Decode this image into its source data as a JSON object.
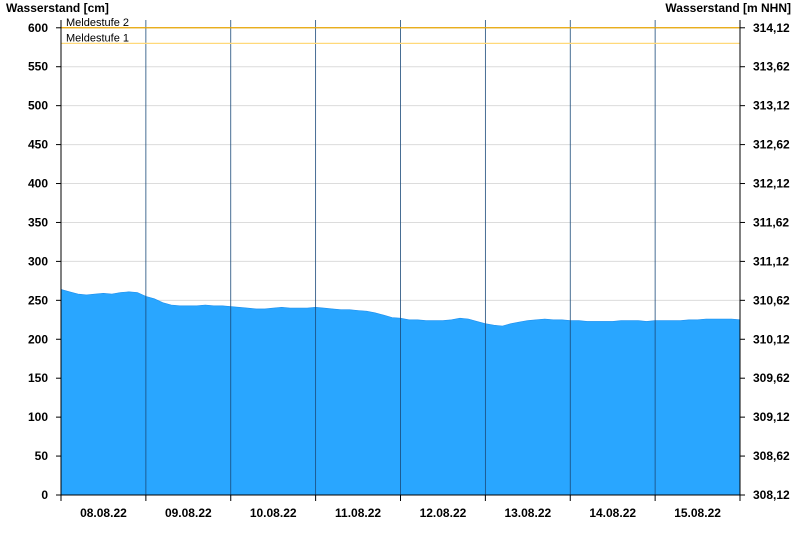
{
  "chart_data": {
    "type": "area",
    "title": "",
    "ylabel_left": "Wasserstand [cm]",
    "ylabel_right": "Wasserstand [m NHN]",
    "ylim": [
      0,
      610
    ],
    "y_ticks_left": [
      0,
      50,
      100,
      150,
      200,
      250,
      300,
      350,
      400,
      450,
      500,
      550,
      600
    ],
    "y_ticks_right": [
      "308,12",
      "308,62",
      "309,12",
      "309,62",
      "310,12",
      "310,62",
      "311,12",
      "311,62",
      "312,12",
      "312,62",
      "313,12",
      "313,62",
      "314,12"
    ],
    "x_ticks": [
      "08.08.22",
      "09.08.22",
      "10.08.22",
      "11.08.22",
      "12.08.22",
      "13.08.22",
      "14.08.22",
      "15.08.22"
    ],
    "x_range_days": [
      0,
      8
    ],
    "grid": true,
    "series": [
      {
        "color": "#29a6ff",
        "points": [
          [
            0.0,
            264
          ],
          [
            0.1,
            261
          ],
          [
            0.2,
            258
          ],
          [
            0.3,
            257
          ],
          [
            0.4,
            258
          ],
          [
            0.5,
            259
          ],
          [
            0.6,
            258
          ],
          [
            0.7,
            260
          ],
          [
            0.8,
            261
          ],
          [
            0.9,
            260
          ],
          [
            1.0,
            255
          ],
          [
            1.1,
            252
          ],
          [
            1.2,
            247
          ],
          [
            1.3,
            244
          ],
          [
            1.4,
            243
          ],
          [
            1.5,
            243
          ],
          [
            1.6,
            243
          ],
          [
            1.7,
            244
          ],
          [
            1.8,
            243
          ],
          [
            1.9,
            243
          ],
          [
            2.0,
            242
          ],
          [
            2.1,
            241
          ],
          [
            2.2,
            240
          ],
          [
            2.3,
            239
          ],
          [
            2.4,
            239
          ],
          [
            2.5,
            240
          ],
          [
            2.6,
            241
          ],
          [
            2.7,
            240
          ],
          [
            2.8,
            240
          ],
          [
            2.9,
            240
          ],
          [
            3.0,
            241
          ],
          [
            3.1,
            240
          ],
          [
            3.2,
            239
          ],
          [
            3.3,
            238
          ],
          [
            3.4,
            238
          ],
          [
            3.5,
            237
          ],
          [
            3.6,
            236
          ],
          [
            3.7,
            234
          ],
          [
            3.8,
            231
          ],
          [
            3.9,
            228
          ],
          [
            4.0,
            227
          ],
          [
            4.1,
            225
          ],
          [
            4.2,
            225
          ],
          [
            4.3,
            224
          ],
          [
            4.4,
            224
          ],
          [
            4.5,
            224
          ],
          [
            4.6,
            225
          ],
          [
            4.7,
            227
          ],
          [
            4.8,
            226
          ],
          [
            4.9,
            223
          ],
          [
            5.0,
            220
          ],
          [
            5.1,
            218
          ],
          [
            5.2,
            217
          ],
          [
            5.3,
            220
          ],
          [
            5.4,
            222
          ],
          [
            5.5,
            224
          ],
          [
            5.6,
            225
          ],
          [
            5.7,
            226
          ],
          [
            5.8,
            225
          ],
          [
            5.9,
            225
          ],
          [
            6.0,
            224
          ],
          [
            6.1,
            224
          ],
          [
            6.2,
            223
          ],
          [
            6.3,
            223
          ],
          [
            6.4,
            223
          ],
          [
            6.5,
            223
          ],
          [
            6.6,
            224
          ],
          [
            6.7,
            224
          ],
          [
            6.8,
            224
          ],
          [
            6.9,
            223
          ],
          [
            7.0,
            224
          ],
          [
            7.1,
            224
          ],
          [
            7.2,
            224
          ],
          [
            7.3,
            224
          ],
          [
            7.4,
            225
          ],
          [
            7.5,
            225
          ],
          [
            7.6,
            226
          ],
          [
            7.7,
            226
          ],
          [
            7.8,
            226
          ],
          [
            7.9,
            226
          ],
          [
            8.0,
            225
          ]
        ]
      }
    ],
    "thresholds": [
      {
        "label": "Meldestufe 2",
        "value": 600,
        "color": "#e8a500"
      },
      {
        "label": "Meldestufe 1",
        "value": 580,
        "color": "#ffd97a"
      }
    ]
  }
}
